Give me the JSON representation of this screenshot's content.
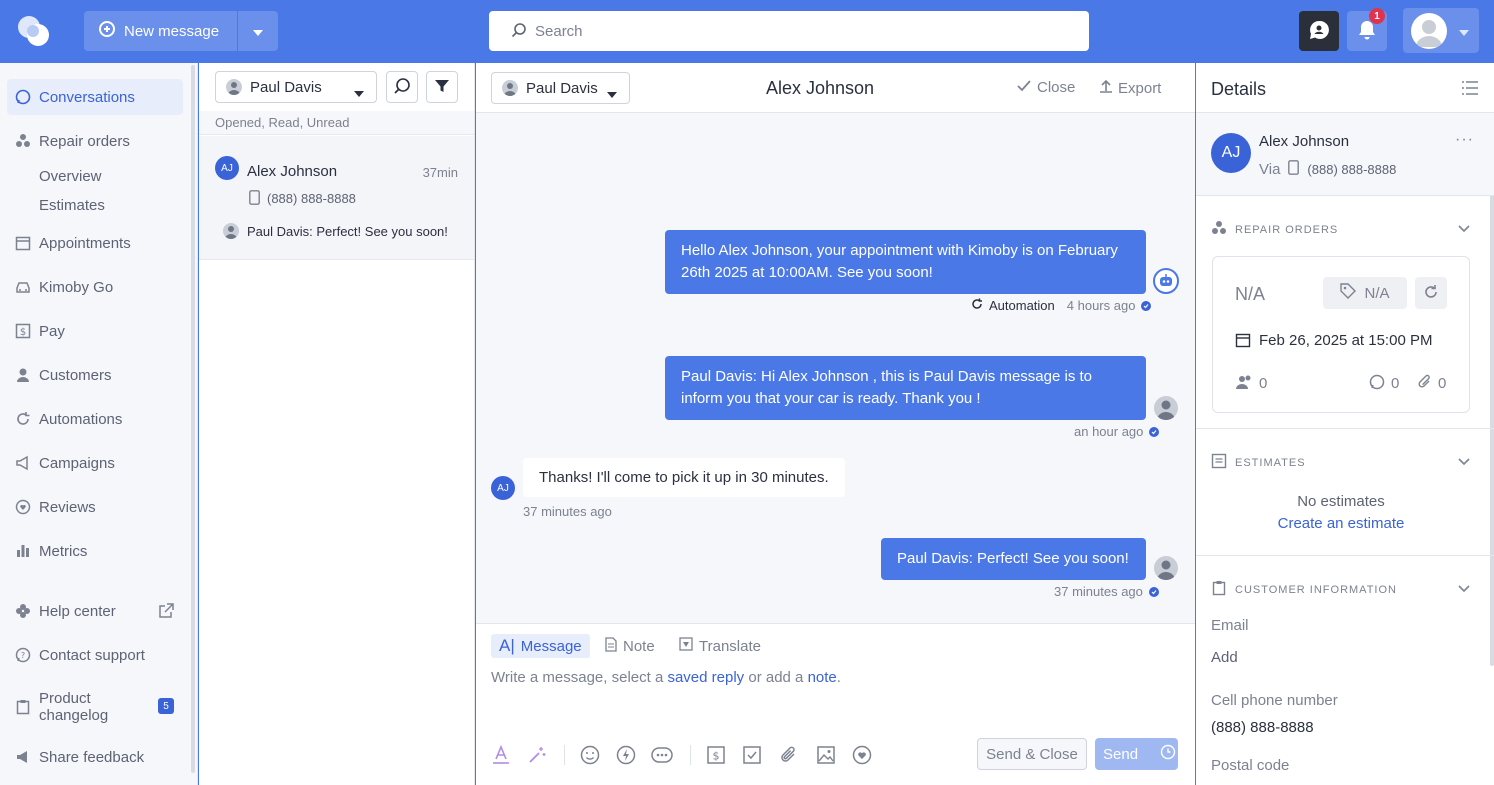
{
  "topbar": {
    "new_message_label": "New message",
    "search_placeholder": "Search",
    "notification_count": "1"
  },
  "sidebar": {
    "items": [
      {
        "label": "Conversations"
      },
      {
        "label": "Repair orders"
      },
      {
        "label": "Overview"
      },
      {
        "label": "Estimates"
      },
      {
        "label": "Appointments"
      },
      {
        "label": "Kimoby Go"
      },
      {
        "label": "Pay"
      },
      {
        "label": "Customers"
      },
      {
        "label": "Automations"
      },
      {
        "label": "Campaigns"
      },
      {
        "label": "Reviews"
      },
      {
        "label": "Metrics"
      },
      {
        "label": "Help center"
      },
      {
        "label": "Contact support"
      },
      {
        "label": "Product changelog",
        "badge": "5"
      },
      {
        "label": "Share feedback"
      }
    ]
  },
  "convlist": {
    "agent": "Paul Davis",
    "filter_text": "Opened, Read, Unread",
    "items": [
      {
        "initials": "AJ",
        "name": "Alex Johnson",
        "time": "37min",
        "phone": "(888) 888-8888",
        "preview": "Paul Davis: Perfect! See you soon!"
      }
    ]
  },
  "chat": {
    "agent": "Paul Davis",
    "title": "Alex Johnson",
    "close_label": "Close",
    "export_label": "Export",
    "messages": [
      {
        "text_line1": "Hello Alex Johnson, your appointment with Kimoby is on February",
        "text_line2": "26th 2025 at 10:00AM. See you soon!",
        "source": "Automation",
        "time": "4 hours ago"
      },
      {
        "text_line1": "Paul Davis: Hi Alex Johnson , this is Paul Davis message is to",
        "text_line2": "inform you that your car is ready. Thank you !",
        "time": "an hour ago"
      },
      {
        "text": "Thanks! I'll come to pick it up in 30 minutes.",
        "time": "37 minutes ago",
        "initials": "AJ"
      },
      {
        "text": "Paul Davis: Perfect! See you soon!",
        "time": "37 minutes ago"
      }
    ],
    "composer": {
      "tab_message": "Message",
      "tab_note": "Note",
      "tab_translate": "Translate",
      "prompt_a": "Write a message, select a ",
      "prompt_link1": "saved reply",
      "prompt_b": " or add a ",
      "prompt_link2": "note",
      "prompt_c": ".",
      "send_close_label": "Send & Close",
      "send_label": "Send"
    }
  },
  "details": {
    "title": "Details",
    "contact": {
      "initials": "AJ",
      "name": "Alex Johnson",
      "via": "Via",
      "phone": "(888) 888-8888"
    },
    "repair_orders": {
      "heading": "REPAIR ORDERS",
      "ro_number": "N/A",
      "tag": "N/A",
      "date": "Feb 26, 2025 at 15:00 PM",
      "people_count": "0",
      "message_count": "0",
      "attachment_count": "0"
    },
    "estimates": {
      "heading": "ESTIMATES",
      "empty": "No estimates",
      "create": "Create an estimate"
    },
    "customer_info": {
      "heading": "CUSTOMER INFORMATION",
      "email_label": "Email",
      "email_value": "Add",
      "phone_label": "Cell phone number",
      "phone_value": "(888) 888-8888",
      "postal_label": "Postal code"
    }
  },
  "colors": {
    "brand": "#4a78e6",
    "accent": "#3a63d8",
    "badge": "#e0344e"
  }
}
